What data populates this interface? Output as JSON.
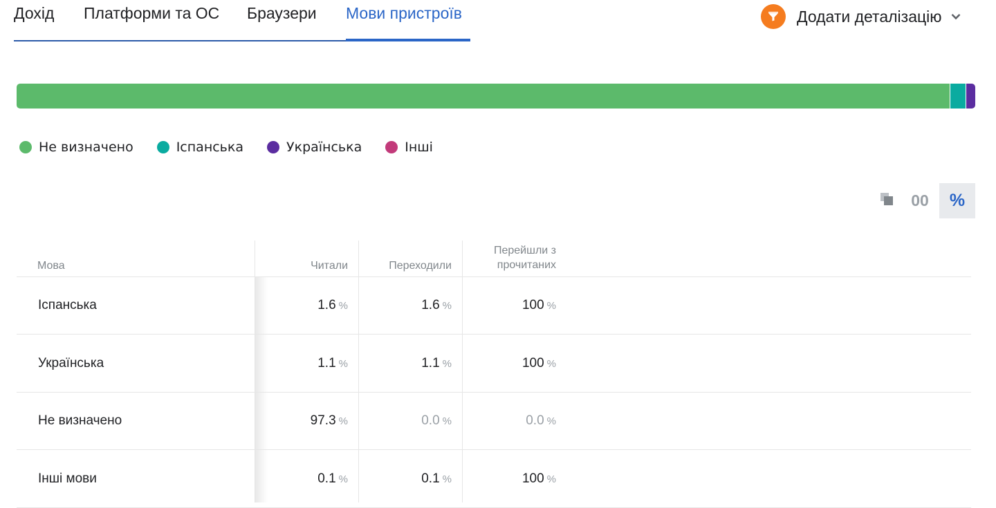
{
  "tabs": [
    {
      "label": "Дохід",
      "active": false
    },
    {
      "label": "Платформи та ОС",
      "active": false
    },
    {
      "label": "Браузери",
      "active": false
    },
    {
      "label": "Мови пристроїв",
      "active": true
    }
  ],
  "add_detail": {
    "label": "Додати деталізацію",
    "icon": "filter-icon",
    "accent": "#f57c1f"
  },
  "distribution": [
    {
      "label": "Не визначено",
      "value": 97.3,
      "color": "#5cba6b"
    },
    {
      "label": "Іспанська",
      "value": 1.6,
      "color": "#0aaba0"
    },
    {
      "label": "Українська",
      "value": 1.1,
      "color": "#5b2da0"
    },
    {
      "label": "Інші",
      "value": 0.1,
      "color": "#c23a7a"
    }
  ],
  "view_toggle": {
    "absolute_label": "00",
    "percent_label": "%",
    "selected": "percent"
  },
  "table": {
    "headers": {
      "language": "Мова",
      "read": "Читали",
      "clicked": "Переходили",
      "conversion_line1": "Перейшли з",
      "conversion_line2": "прочитаних"
    },
    "unit": "%",
    "rows": [
      {
        "language": "Іспанська",
        "read": "1.6",
        "clicked": "1.6",
        "conversion": "100"
      },
      {
        "language": "Українська",
        "read": "1.1",
        "clicked": "1.1",
        "conversion": "100"
      },
      {
        "language": "Не визначено",
        "read": "97.3",
        "clicked": "0.0",
        "conversion": "0.0"
      },
      {
        "language": "Інші мови",
        "read": "0.1",
        "clicked": "0.1",
        "conversion": "100"
      }
    ]
  }
}
